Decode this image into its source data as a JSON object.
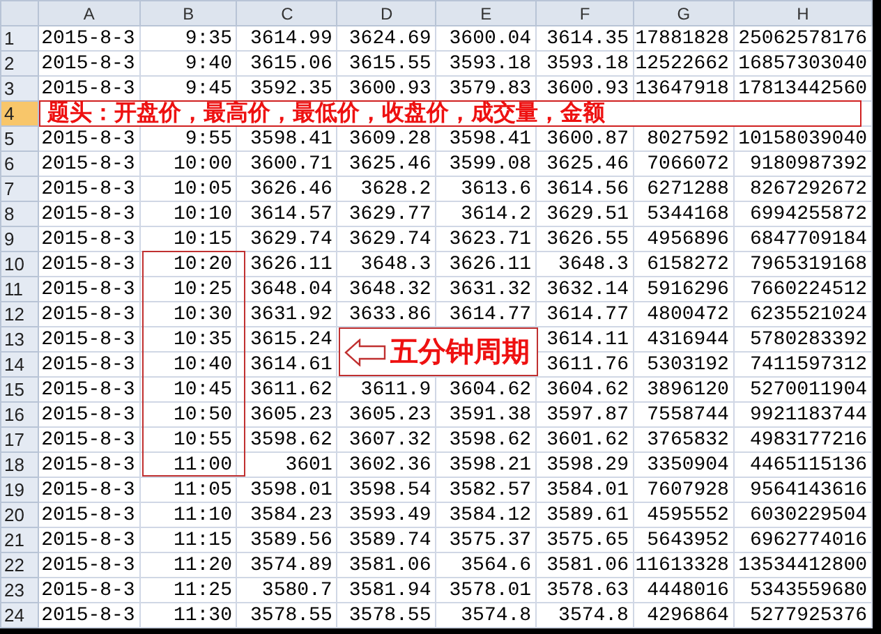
{
  "columns": [
    "A",
    "B",
    "C",
    "D",
    "E",
    "F",
    "G",
    "H"
  ],
  "rows": [
    {
      "number": "1",
      "selected": false,
      "cells": [
        "2015-8-3",
        "9:35",
        "3614.99",
        "3624.69",
        "3600.04",
        "3614.35",
        "17881828",
        "25062578176"
      ]
    },
    {
      "number": "2",
      "selected": false,
      "cells": [
        "2015-8-3",
        "9:40",
        "3615.06",
        "3615.55",
        "3593.18",
        "3593.18",
        "12522662",
        "16857303040"
      ]
    },
    {
      "number": "3",
      "selected": false,
      "cells": [
        "2015-8-3",
        "9:45",
        "3592.35",
        "3600.93",
        "3579.83",
        "3600.93",
        "13647918",
        "17813442560"
      ]
    },
    {
      "number": "4",
      "selected": true,
      "cells": [
        null,
        null,
        null,
        null,
        null,
        null,
        null,
        null
      ]
    },
    {
      "number": "5",
      "selected": false,
      "cells": [
        "2015-8-3",
        "9:55",
        "3598.41",
        "3609.28",
        "3598.41",
        "3600.87",
        "8027592",
        "10158039040"
      ]
    },
    {
      "number": "6",
      "selected": false,
      "cells": [
        "2015-8-3",
        "10:00",
        "3600.71",
        "3625.46",
        "3599.08",
        "3625.46",
        "7066072",
        "9180987392"
      ]
    },
    {
      "number": "7",
      "selected": false,
      "cells": [
        "2015-8-3",
        "10:05",
        "3626.46",
        "3628.2",
        "3613.6",
        "3614.56",
        "6271288",
        "8267292672"
      ]
    },
    {
      "number": "8",
      "selected": false,
      "cells": [
        "2015-8-3",
        "10:10",
        "3614.57",
        "3629.77",
        "3614.2",
        "3629.51",
        "5344168",
        "6994255872"
      ]
    },
    {
      "number": "9",
      "selected": false,
      "cells": [
        "2015-8-3",
        "10:15",
        "3629.74",
        "3629.74",
        "3623.71",
        "3626.55",
        "4956896",
        "6847709184"
      ]
    },
    {
      "number": "10",
      "selected": false,
      "cells": [
        "2015-8-3",
        "10:20",
        "3626.11",
        "3648.3",
        "3626.11",
        "3648.3",
        "6158272",
        "7965319168"
      ]
    },
    {
      "number": "11",
      "selected": false,
      "cells": [
        "2015-8-3",
        "10:25",
        "3648.04",
        "3648.32",
        "3631.32",
        "3632.14",
        "5916296",
        "7660224512"
      ]
    },
    {
      "number": "12",
      "selected": false,
      "cells": [
        "2015-8-3",
        "10:30",
        "3631.92",
        "3633.86",
        "3614.77",
        "3614.77",
        "4800472",
        "6235521024"
      ]
    },
    {
      "number": "13",
      "selected": false,
      "cells": [
        "2015-8-3",
        "10:35",
        "3615.24",
        null,
        null,
        "3614.11",
        "4316944",
        "5780283392"
      ]
    },
    {
      "number": "14",
      "selected": false,
      "cells": [
        "2015-8-3",
        "10:40",
        "3614.61",
        null,
        null,
        "3611.76",
        "5303192",
        "7411597312"
      ]
    },
    {
      "number": "15",
      "selected": false,
      "cells": [
        "2015-8-3",
        "10:45",
        "3611.62",
        "3611.9",
        "3604.62",
        "3604.62",
        "3896120",
        "5270011904"
      ]
    },
    {
      "number": "16",
      "selected": false,
      "cells": [
        "2015-8-3",
        "10:50",
        "3605.23",
        "3605.23",
        "3591.38",
        "3597.87",
        "7558744",
        "9921183744"
      ]
    },
    {
      "number": "17",
      "selected": false,
      "cells": [
        "2015-8-3",
        "10:55",
        "3598.62",
        "3607.32",
        "3598.62",
        "3601.62",
        "3765832",
        "4983177216"
      ]
    },
    {
      "number": "18",
      "selected": false,
      "cells": [
        "2015-8-3",
        "11:00",
        "3601",
        "3602.36",
        "3598.21",
        "3598.29",
        "3350904",
        "4465115136"
      ]
    },
    {
      "number": "19",
      "selected": false,
      "cells": [
        "2015-8-3",
        "11:05",
        "3598.01",
        "3598.54",
        "3582.57",
        "3584.01",
        "7607928",
        "9564143616"
      ]
    },
    {
      "number": "20",
      "selected": false,
      "cells": [
        "2015-8-3",
        "11:10",
        "3584.23",
        "3593.49",
        "3584.12",
        "3589.61",
        "4595552",
        "6030229504"
      ]
    },
    {
      "number": "21",
      "selected": false,
      "cells": [
        "2015-8-3",
        "11:15",
        "3589.56",
        "3589.74",
        "3575.37",
        "3575.65",
        "5643952",
        "6962774016"
      ]
    },
    {
      "number": "22",
      "selected": false,
      "cells": [
        "2015-8-3",
        "11:20",
        "3574.89",
        "3581.06",
        "3564.6",
        "3581.06",
        "11613328",
        "13534412800"
      ]
    },
    {
      "number": "23",
      "selected": false,
      "cells": [
        "2015-8-3",
        "11:25",
        "3580.7",
        "3581.94",
        "3578.01",
        "3578.63",
        "4448016",
        "5343559680"
      ]
    },
    {
      "number": "24",
      "selected": false,
      "cells": [
        "2015-8-3",
        "11:30",
        "3578.55",
        "3578.55",
        "3574.8",
        "3574.8",
        "4296864",
        "5277925376"
      ]
    }
  ],
  "annotations": {
    "header_note": "题头：开盘价，最高价，最低价，收盘价，成交量，金额",
    "period_note": "五分钟周期"
  }
}
